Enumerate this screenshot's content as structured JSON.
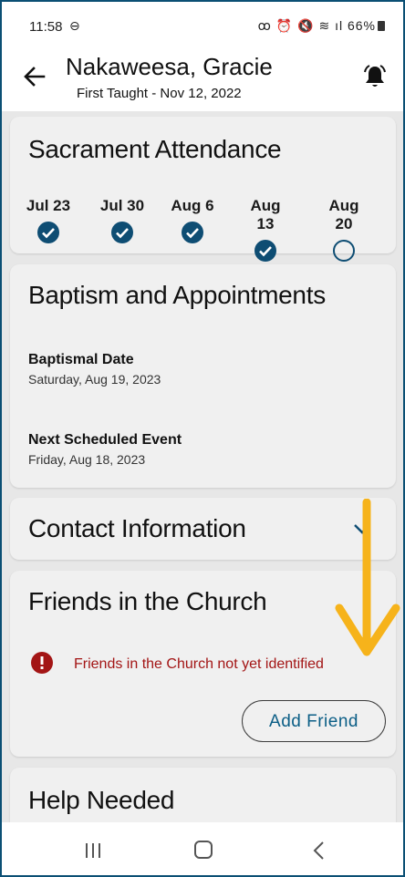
{
  "status": {
    "time": "11:58",
    "time_icon": "⊖",
    "icons": "ꝏ ⏰ 🔇 ≋ ıl 66%",
    "battery_icon": "battery-icon"
  },
  "header": {
    "title": "Nakaweesa, Gracie",
    "subtitle": "First Taught - Nov 12, 2022"
  },
  "sacrament": {
    "title": "Sacrament Attendance",
    "items": [
      {
        "date": "Jul 23",
        "attended": true
      },
      {
        "date": "Jul 30",
        "attended": true
      },
      {
        "date": "Aug 6",
        "attended": true
      },
      {
        "date": "Aug 13",
        "attended": true
      },
      {
        "date": "Aug 20",
        "attended": false
      }
    ]
  },
  "baptism": {
    "title": "Baptism and Appointments",
    "baptismal_label": "Baptismal Date",
    "baptismal_value": "Saturday, Aug 19, 2023",
    "event_label": "Next Scheduled Event",
    "event_value": "Friday, Aug 18, 2023"
  },
  "contact": {
    "title": "Contact Information"
  },
  "friends": {
    "title": "Friends in the Church",
    "warning": "Friends in the Church not yet identified",
    "add_button": "Add Friend"
  },
  "help": {
    "title": "Help Needed"
  },
  "colors": {
    "accent": "#0b5e86",
    "check_fill": "#0e4d73",
    "warning": "#a31515",
    "arrow": "#f6b31b"
  }
}
